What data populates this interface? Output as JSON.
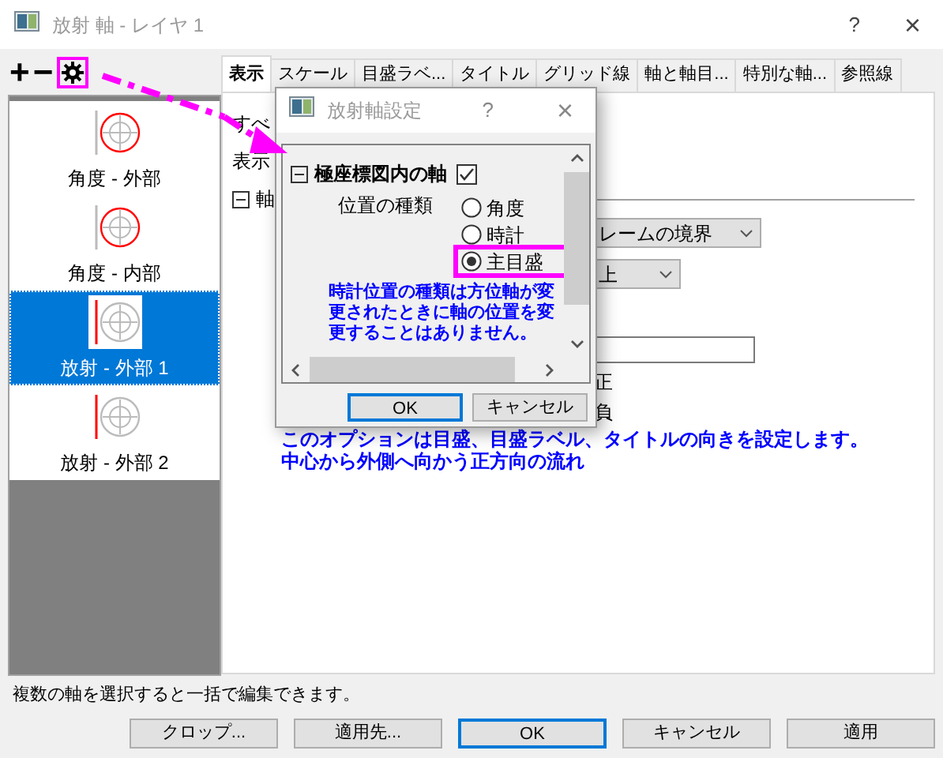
{
  "window": {
    "title": "放射 軸 - レイヤ 1",
    "help": "?",
    "close": "×"
  },
  "toolbar": {
    "add": "+",
    "remove": "−",
    "settings_highlighted": true
  },
  "axes": [
    {
      "label": "角度 - 外部",
      "kind": "angular",
      "selected": false
    },
    {
      "label": "角度 - 内部",
      "kind": "angular",
      "selected": false
    },
    {
      "label": "放射 - 外部 1",
      "kind": "radial",
      "selected": true
    },
    {
      "label": "放射 - 外部 2",
      "kind": "radial",
      "selected": false
    }
  ],
  "tabs": [
    {
      "label": "表示",
      "selected": true
    },
    {
      "label": "スケール",
      "selected": false
    },
    {
      "label": "目盛ラベ...",
      "selected": false
    },
    {
      "label": "タイトル",
      "selected": false
    },
    {
      "label": "グリッド線",
      "selected": false
    },
    {
      "label": "軸と軸目...",
      "selected": false
    },
    {
      "label": "特別な軸...",
      "selected": false
    },
    {
      "label": "参照線",
      "selected": false
    }
  ],
  "tab_page": {
    "label_1": "すべ",
    "label_2": "表示",
    "group": {
      "label": "軸",
      "expanded": true
    },
    "dropdown_1": "レームの境界",
    "dropdown_2": "上",
    "option_1": "正",
    "option_2": "負",
    "note_lines": [
      "このオプションは目盛、目盛ラベル、タイトルの向きを設定します。",
      "中心から外側へ向かう正方向の流れ"
    ]
  },
  "status_text": "複数の軸を選択すると一括で編集できます。",
  "buttons": [
    {
      "label": "クロップ...",
      "default": false
    },
    {
      "label": "適用先...",
      "default": false
    },
    {
      "label": "OK",
      "default": true
    },
    {
      "label": "キャンセル",
      "default": false
    },
    {
      "label": "適用",
      "default": false
    }
  ],
  "subdialog": {
    "title": "放射軸設定",
    "help": "?",
    "close": "×",
    "group": {
      "label": "極座標図内の軸",
      "expanded": true,
      "checked": true
    },
    "position_label": "位置の種類",
    "position_options": [
      {
        "label": "角度",
        "selected": false,
        "highlighted": false
      },
      {
        "label": "時計",
        "selected": false,
        "highlighted": false
      },
      {
        "label": "主目盛",
        "selected": true,
        "highlighted": true
      }
    ],
    "note": "時計位置の種類は方位軸が変更されたときに軸の位置を変更することはありません。",
    "buttons": [
      {
        "label": "OK",
        "default": true
      },
      {
        "label": "キャンセル",
        "default": false
      }
    ]
  }
}
